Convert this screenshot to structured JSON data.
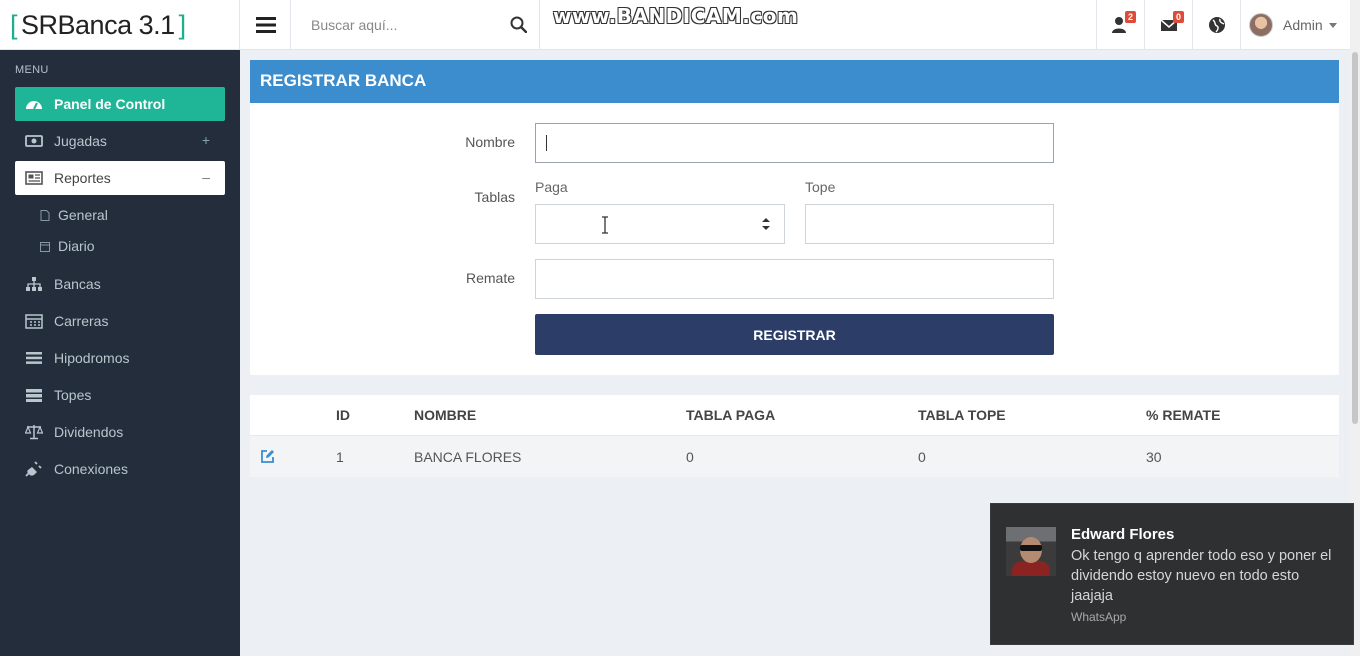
{
  "brand": {
    "bracket_open": "[",
    "name": "SRBanca 3.1",
    "bracket_close": "]",
    "accent_color": "#1fae8e"
  },
  "search": {
    "placeholder": "Buscar aquí..."
  },
  "watermark": "www.BANDICAM.com",
  "navbar": {
    "users_badge": "2",
    "messages_badge": "0",
    "user_name": "Admin"
  },
  "sidebar": {
    "header": "MENU",
    "items": [
      {
        "label": "Panel de Control",
        "icon": "dashboard-icon"
      },
      {
        "label": "Jugadas",
        "icon": "money-icon",
        "toggle": "+"
      },
      {
        "label": "Reportes",
        "icon": "newspaper-icon",
        "toggle": "–"
      },
      {
        "label": "General",
        "icon": "file-icon"
      },
      {
        "label": "Diario",
        "icon": "calendar-icon"
      },
      {
        "label": "Bancas",
        "icon": "sitemap-icon"
      },
      {
        "label": "Carreras",
        "icon": "calendar-grid-icon"
      },
      {
        "label": "Hipodromos",
        "icon": "list-icon"
      },
      {
        "label": "Topes",
        "icon": "server-icon"
      },
      {
        "label": "Dividendos",
        "icon": "balance-scale-icon"
      },
      {
        "label": "Conexiones",
        "icon": "plug-icon"
      }
    ]
  },
  "form": {
    "title": "REGISTRAR BANCA",
    "nombre_label": "Nombre",
    "nombre_value": "",
    "tablas_label": "Tablas",
    "paga_label": "Paga",
    "paga_value": "",
    "tope_label": "Tope",
    "tope_value": "",
    "remate_label": "Remate",
    "remate_value": "",
    "submit_label": "REGISTRAR",
    "header_color": "#3c8dce",
    "button_color": "#2c3e67"
  },
  "table": {
    "columns": [
      "ID",
      "NOMBRE",
      "TABLA PAGA",
      "TABLA TOPE",
      "% REMATE"
    ],
    "rows": [
      {
        "id": "1",
        "nombre": "BANCA FLORES",
        "tabla_paga": "0",
        "tabla_tope": "0",
        "remate": "30"
      }
    ]
  },
  "notification": {
    "sender": "Edward Flores",
    "message": "Ok tengo q aprender todo eso y poner el dividendo estoy nuevo en todo esto jaajaja",
    "app": "WhatsApp"
  }
}
